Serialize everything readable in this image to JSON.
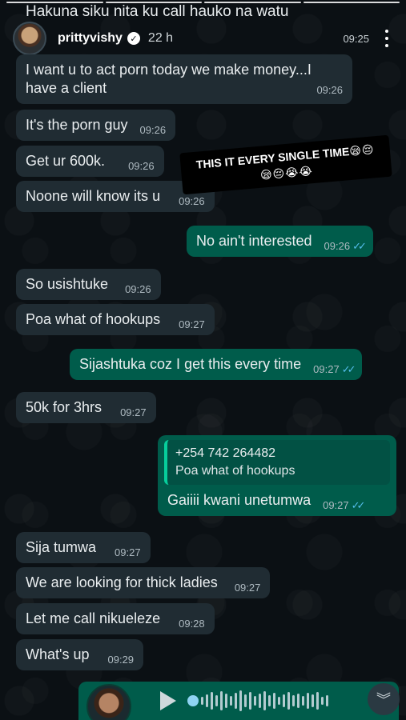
{
  "story": {
    "caption": "Hakuna siku nita ku call hauko na watu",
    "username": "prittyvishy",
    "age": "22 h",
    "header_time": "09:25"
  },
  "overlay": {
    "text": "THIS IT EVERY SINGLE TIME",
    "emoji_line1": "😪😔",
    "emoji_line2": "😪😔😭😭"
  },
  "messages": [
    {
      "dir": "in",
      "text": "I want u to act porn today we make money...I have a client",
      "time": "09:26"
    },
    {
      "dir": "in",
      "text": "It's the porn guy",
      "time": "09:26"
    },
    {
      "dir": "in",
      "text": "Get ur 600k.",
      "time": "09:26"
    },
    {
      "dir": "in",
      "text": "Noone will know its u",
      "time": "09:26"
    },
    {
      "dir": "out",
      "text": "No ain't interested",
      "time": "09:26"
    },
    {
      "dir": "in",
      "text": "So usishtuke",
      "time": "09:26"
    },
    {
      "dir": "in",
      "text": "Poa what of hookups",
      "time": "09:27"
    },
    {
      "dir": "out",
      "text": "Sijashtuka coz I get this every time",
      "time": "09:27"
    },
    {
      "dir": "in",
      "text": "50k for 3hrs",
      "time": "09:27"
    },
    {
      "dir": "out",
      "text": "Gaiiii kwani unetumwa",
      "time": "09:27",
      "quote_name": "+254 742 264482",
      "quote_text": "Poa what of hookups"
    },
    {
      "dir": "in",
      "text": "Sija tumwa",
      "time": "09:27"
    },
    {
      "dir": "in",
      "text": "We are looking for thick ladies",
      "time": "09:27"
    },
    {
      "dir": "in",
      "text": "Let me call nikueleze",
      "time": "09:28"
    },
    {
      "dir": "in",
      "text": "What's up",
      "time": "09:29"
    }
  ],
  "ticks": "✓✓",
  "icons": {
    "verified": "check-badge-icon",
    "more": "more-vertical-icon",
    "play": "play-icon",
    "scroll": "chevron-double-down-icon"
  },
  "colors": {
    "incoming": "#202c33",
    "outgoing": "#005c4b",
    "read_ticks": "#53bdeb"
  }
}
